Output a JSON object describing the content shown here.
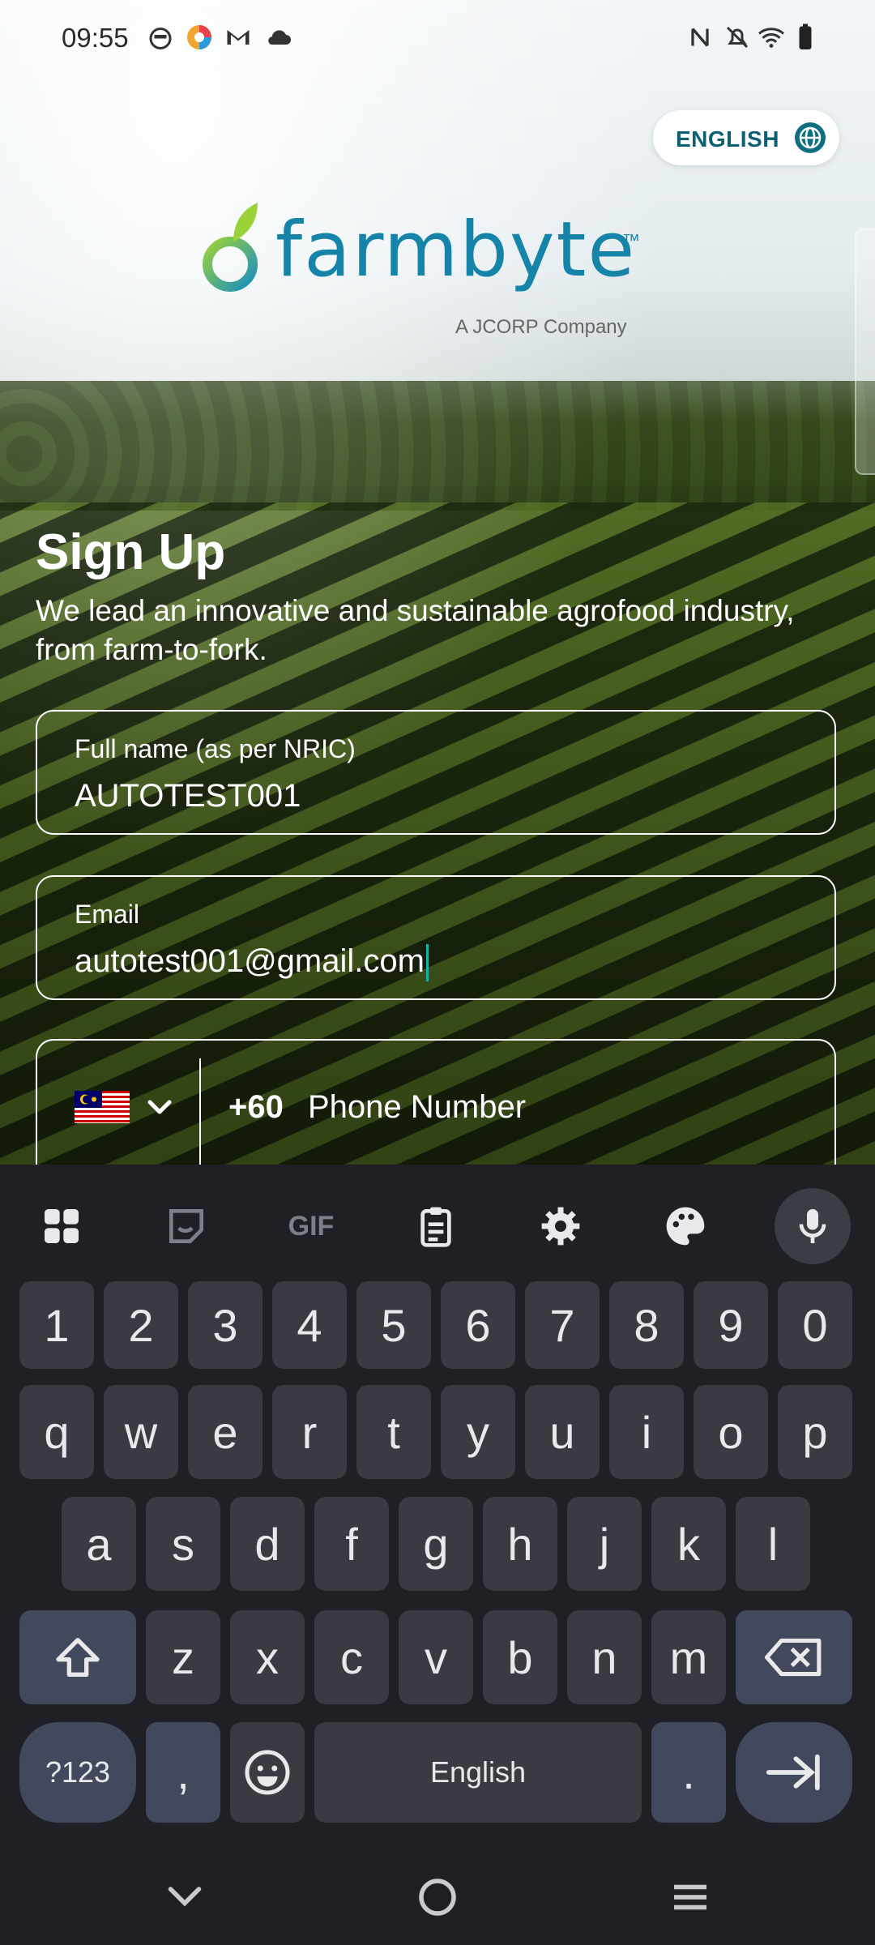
{
  "status_bar": {
    "time": "09:55",
    "left_icons": [
      "face-icon",
      "color-app-icon",
      "gmail-icon",
      "cloud-icon"
    ],
    "right_icons": [
      "nfc-icon",
      "bell-off-icon",
      "wifi-icon",
      "battery-icon"
    ]
  },
  "language": {
    "label": "ENGLISH",
    "icon": "globe-icon"
  },
  "logo": {
    "word": "farmbyte",
    "tm": "™",
    "sub": "A JCORP Company"
  },
  "header": {
    "title": "Sign Up",
    "subtitle": "We lead an innovative and sustainable agrofood industry, from farm-to-fork."
  },
  "form": {
    "full_name": {
      "label": "Full name (as per NRIC)",
      "value": "AUTOTEST001"
    },
    "email": {
      "label": "Email",
      "value": "autotest001@gmail.com"
    },
    "phone": {
      "country_code": "+60",
      "placeholder": "Phone Number",
      "flag": "malaysia-flag"
    }
  },
  "keyboard": {
    "toolbar": [
      "apps-icon",
      "sticker-icon",
      "gif-icon",
      "clipboard-icon",
      "settings-icon",
      "palette-icon",
      "mic-icon"
    ],
    "toolbar_gif_label": "GIF",
    "row_numbers": [
      "1",
      "2",
      "3",
      "4",
      "5",
      "6",
      "7",
      "8",
      "9",
      "0"
    ],
    "row1": [
      "q",
      "w",
      "e",
      "r",
      "t",
      "y",
      "u",
      "i",
      "o",
      "p"
    ],
    "row2": [
      "a",
      "s",
      "d",
      "f",
      "g",
      "h",
      "j",
      "k",
      "l"
    ],
    "row3": [
      "z",
      "x",
      "c",
      "v",
      "b",
      "n",
      "m"
    ],
    "symbols_label": "?123",
    "comma_label": ",",
    "space_label": "English",
    "period_label": ".",
    "shift_icon": "shift-icon",
    "backspace_icon": "backspace-icon",
    "emoji_icon": "emoji-icon",
    "next_icon": "next-tab-icon"
  },
  "nav_bar": [
    "hide-keyboard-icon",
    "home-icon",
    "menu-icon"
  ],
  "colors": {
    "brand": "#1684a8",
    "accent_text": "#0d5f72",
    "keyboard_bg": "#1f2026",
    "key": "#3a3b42",
    "key_dark": "#43495c",
    "caret": "#19b3a5"
  }
}
